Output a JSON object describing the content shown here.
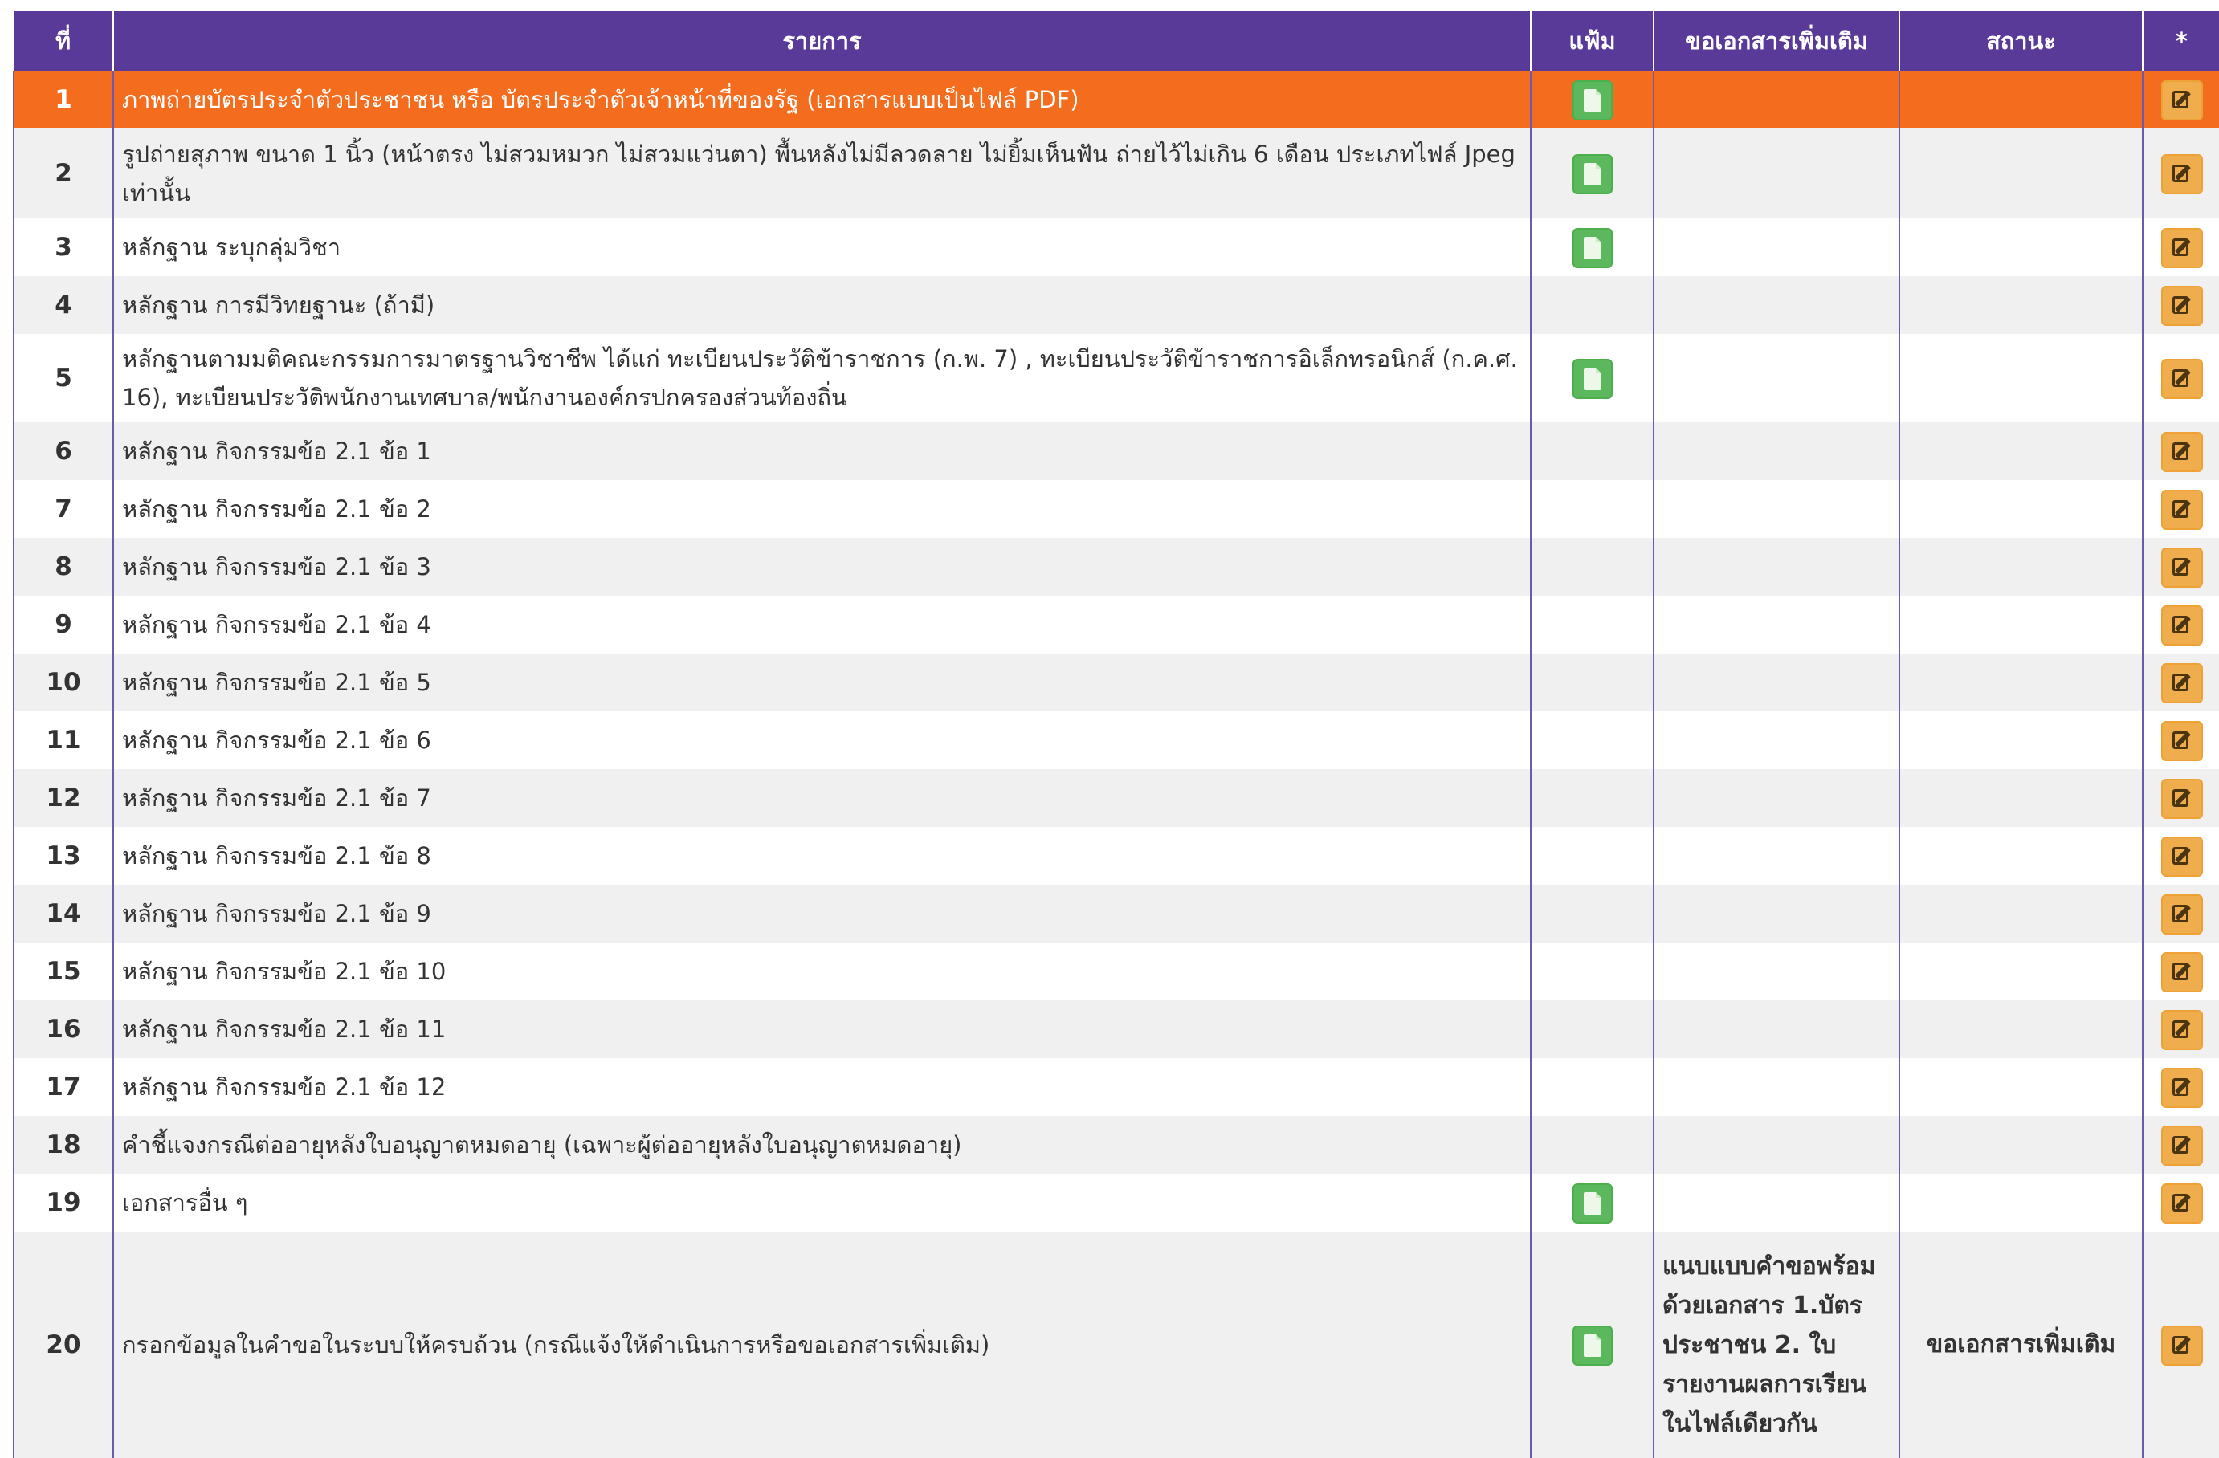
{
  "headers": {
    "no": "ที่",
    "item": "รายการ",
    "file": "แฟ้ม",
    "request": "ขอเอกสารเพิ่มเติม",
    "status": "สถานะ",
    "action": "*"
  },
  "colors": {
    "header_bg": "#5a3a98",
    "highlight_row": "#f46d1e",
    "file_button": "#5cb85c",
    "edit_button": "#f0ad4e"
  },
  "icons": {
    "file": "file-icon",
    "edit": "edit-icon"
  },
  "rows": [
    {
      "no": "1",
      "item": "ภาพถ่ายบัตรประจำตัวประชาชน หรือ บัตรประจำตัวเจ้าหน้าที่ของรัฐ (เอกสารแบบเป็นไฟล์ PDF)",
      "has_file": true,
      "request": "",
      "status": ""
    },
    {
      "no": "2",
      "item": "รูปถ่ายสุภาพ ขนาด 1 นิ้ว (หน้าตรง ไม่สวมหมวก ไม่สวมแว่นตา) พื้นหลังไม่มีลวดลาย ไม่ยิ้มเห็นฟัน ถ่ายไว้ไม่เกิน 6 เดือน ประเภทไฟล์ Jpeg เท่านั้น",
      "has_file": true,
      "request": "",
      "status": ""
    },
    {
      "no": "3",
      "item": "หลักฐาน ระบุกลุ่มวิชา",
      "has_file": true,
      "request": "",
      "status": ""
    },
    {
      "no": "4",
      "item": "หลักฐาน การมีวิทยฐานะ (ถ้ามี)",
      "has_file": false,
      "request": "",
      "status": ""
    },
    {
      "no": "5",
      "item": "หลักฐานตามมติคณะกรรมการมาตรฐานวิชาชีพ ได้แก่ ทะเบียนประวัติข้าราชการ (ก.พ. 7) , ทะเบียนประวัติข้าราชการอิเล็กทรอนิกส์ (ก.ค.ศ. 16), ทะเบียนประวัติพนักงานเทศบาล/พนักงานองค์กรปกครองส่วนท้องถิ่น",
      "has_file": true,
      "request": "",
      "status": ""
    },
    {
      "no": "6",
      "item": "หลักฐาน กิจกรรมข้อ 2.1 ข้อ 1",
      "has_file": false,
      "request": "",
      "status": ""
    },
    {
      "no": "7",
      "item": "หลักฐาน กิจกรรมข้อ 2.1 ข้อ 2",
      "has_file": false,
      "request": "",
      "status": ""
    },
    {
      "no": "8",
      "item": "หลักฐาน กิจกรรมข้อ 2.1 ข้อ 3",
      "has_file": false,
      "request": "",
      "status": ""
    },
    {
      "no": "9",
      "item": "หลักฐาน กิจกรรมข้อ 2.1 ข้อ 4",
      "has_file": false,
      "request": "",
      "status": ""
    },
    {
      "no": "10",
      "item": "หลักฐาน กิจกรรมข้อ 2.1 ข้อ 5",
      "has_file": false,
      "request": "",
      "status": ""
    },
    {
      "no": "11",
      "item": "หลักฐาน กิจกรรมข้อ 2.1 ข้อ 6",
      "has_file": false,
      "request": "",
      "status": ""
    },
    {
      "no": "12",
      "item": "หลักฐาน กิจกรรมข้อ 2.1 ข้อ 7",
      "has_file": false,
      "request": "",
      "status": ""
    },
    {
      "no": "13",
      "item": "หลักฐาน กิจกรรมข้อ 2.1 ข้อ 8",
      "has_file": false,
      "request": "",
      "status": ""
    },
    {
      "no": "14",
      "item": "หลักฐาน กิจกรรมข้อ 2.1 ข้อ 9",
      "has_file": false,
      "request": "",
      "status": ""
    },
    {
      "no": "15",
      "item": "หลักฐาน กิจกรรมข้อ 2.1 ข้อ 10",
      "has_file": false,
      "request": "",
      "status": ""
    },
    {
      "no": "16",
      "item": "หลักฐาน กิจกรรมข้อ 2.1 ข้อ 11",
      "has_file": false,
      "request": "",
      "status": ""
    },
    {
      "no": "17",
      "item": "หลักฐาน กิจกรรมข้อ 2.1 ข้อ 12",
      "has_file": false,
      "request": "",
      "status": ""
    },
    {
      "no": "18",
      "item": "คำชี้แจงกรณีต่ออายุหลังใบอนุญาตหมดอายุ (เฉพาะผู้ต่ออายุหลังใบอนุญาตหมดอายุ)",
      "has_file": false,
      "request": "",
      "status": ""
    },
    {
      "no": "19",
      "item": "เอกสารอื่น ๆ",
      "has_file": true,
      "request": "",
      "status": ""
    },
    {
      "no": "20",
      "item": "กรอกข้อมูลในคำขอในระบบให้ครบถ้วน (กรณีแจ้งให้ดำเนินการหรือขอเอกสารเพิ่มเติม)",
      "has_file": true,
      "request": "แนบแบบคำขอพร้อมด้วยเอกสาร 1.บัตรประชาชน 2. ใบรายงานผลการเรียนในไฟล์เดียวกัน",
      "status": "ขอเอกสารเพิ่มเติม"
    }
  ]
}
